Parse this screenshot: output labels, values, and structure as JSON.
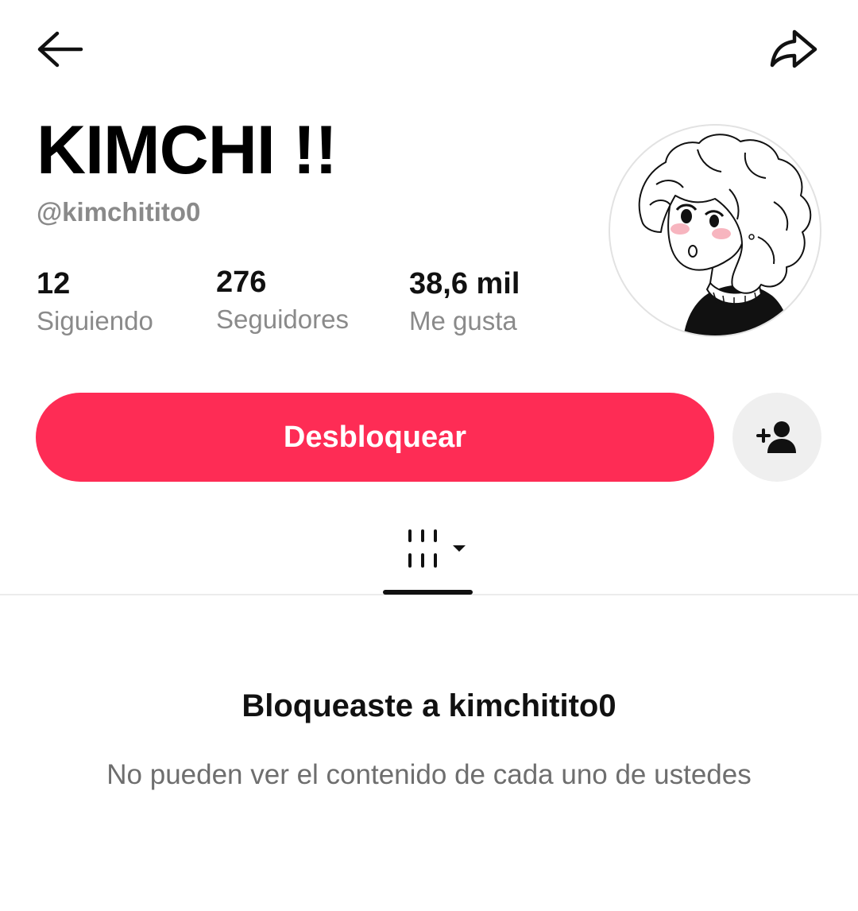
{
  "header": {
    "back_icon": "arrow-left-icon",
    "share_icon": "share-arrow-icon"
  },
  "profile": {
    "display_name": "KIMCHI !!",
    "handle": "@kimchitito0",
    "avatar_icon": "profile-avatar-drawing"
  },
  "stats": [
    {
      "value": "12",
      "label": "Siguiendo"
    },
    {
      "value": "276",
      "label": "Seguidores"
    },
    {
      "value": "38,6 mil",
      "label": "Me gusta"
    }
  ],
  "actions": {
    "unblock_label": "Desbloquear",
    "add_friend_icon": "add-person-icon"
  },
  "tabs": {
    "active_icon": "videos-grid-icon",
    "dropdown_icon": "caret-down-icon"
  },
  "blocked": {
    "title": "Bloqueaste a kimchitito0",
    "description": "No pueden ver el contenido de cada uno de ustedes"
  },
  "colors": {
    "accent": "#fe2c55",
    "muted_text": "#8a8a8a",
    "button_gray": "#efefef"
  }
}
